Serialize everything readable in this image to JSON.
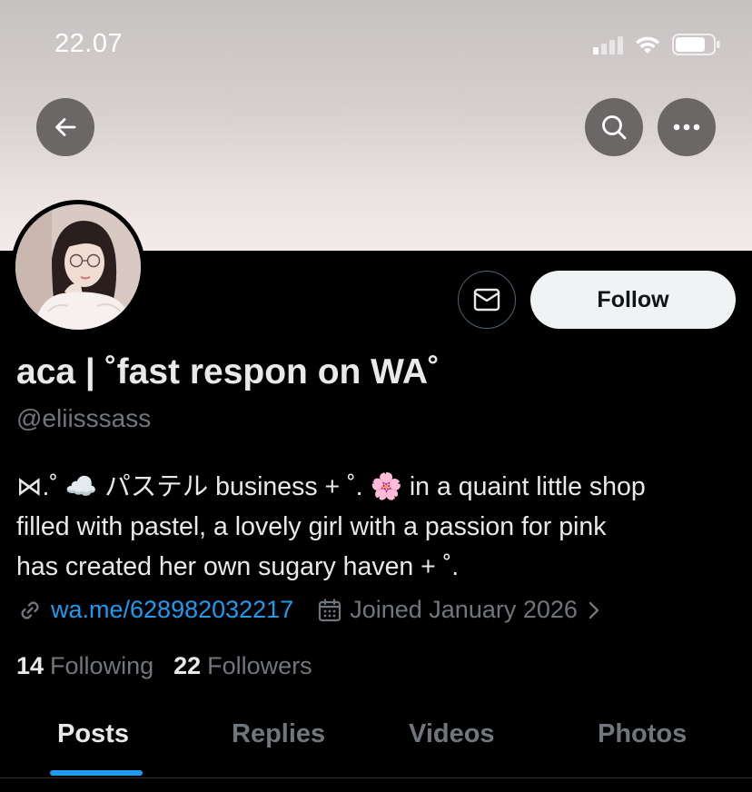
{
  "status_bar": {
    "time": "22.07"
  },
  "profile": {
    "display_name": "aca | ˚fast respon on WA˚",
    "handle": "@eliisssass",
    "bio_lines": [
      "⋈.˚ ☁️ パステル business + ˚. 🌸 in a quaint little shop",
      "filled with pastel, a lovely girl with a passion for pink",
      "has created her own sugary haven + ˚."
    ],
    "link": "wa.me/628982032217",
    "joined": "Joined January 2026",
    "following_count": "14",
    "following_label": "Following",
    "followers_count": "22",
    "followers_label": "Followers"
  },
  "actions": {
    "follow_label": "Follow"
  },
  "tabs": [
    {
      "label": "Posts",
      "active": true
    },
    {
      "label": "Replies",
      "active": false
    },
    {
      "label": "Videos",
      "active": false
    },
    {
      "label": "Photos",
      "active": false
    }
  ],
  "icons": {
    "back": "arrow-left-icon",
    "search": "search-icon",
    "more": "more-icon",
    "message": "mail-icon",
    "link": "link-icon",
    "calendar": "calendar-icon",
    "chevron": "chevron-right-icon"
  },
  "colors": {
    "accent": "#1d9bf0",
    "background": "#000000",
    "secondary_text": "#71767b",
    "follow_button": "#eff3f4"
  }
}
